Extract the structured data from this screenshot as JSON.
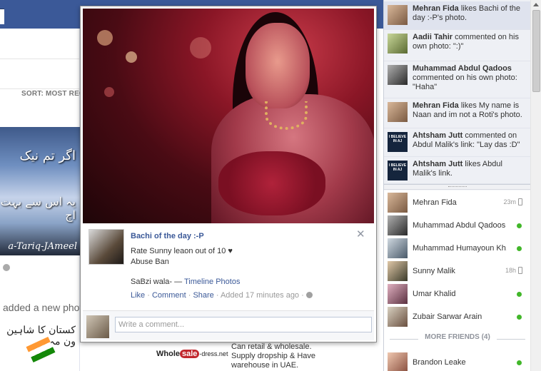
{
  "background": {
    "sort_label": "SORT: MOST REC",
    "added_text": "added a new photo",
    "image_caption_urdu_1": "اگر تم نیک",
    "image_caption_urdu_2": "یہ اس سے بہت اچ",
    "image_signature": "a-Tariq-JAmeel",
    "post_urdu_text": "کستان کا شاہین ون مہ",
    "ad_logo_pre": "Whole",
    "ad_logo_sale": "sale",
    "ad_logo_post": "-dress.net",
    "ad_text": "Can retail & wholesale. Supply dropship & Have warehouse in UAE."
  },
  "photo_viewer": {
    "album_title": "Bachi of the day :-P",
    "caption_line_1": "Rate Sunny leaon out of 10 ♥",
    "caption_line_2": "Abuse Ban",
    "source_prefix": "SaBzi wala- — ",
    "source_link": "Timeline Photos",
    "like": "Like",
    "comment": "Comment",
    "share": "Share",
    "timestamp": "Added 17 minutes ago",
    "close_glyph": "✕",
    "comment_placeholder": "Write a comment..."
  },
  "ticker": [
    {
      "name": "Mehran Fida",
      "text": " likes Bachi of the day :-P's photo.",
      "active": true,
      "avatar": "photo"
    },
    {
      "name": "Aadii Tahir",
      "text": " commented on his own photo: \":)\"",
      "active": false,
      "avatar": "photo"
    },
    {
      "name": "Muhammad Abdul Qadoos",
      "text": " commented on his own photo: \"Haha\"",
      "active": false,
      "avatar": "photo"
    },
    {
      "name": "Mehran Fida",
      "text": " likes My name is Naan and im not a Roti's photo.",
      "active": false,
      "avatar": "photo"
    },
    {
      "name": "Ahtsham Jutt",
      "text": " commented on Abdul Malik's link: \"Lay das :D\"",
      "active": false,
      "avatar": "believe"
    },
    {
      "name": "Ahtsham Jutt",
      "text": " likes Abdul Malik's link.",
      "active": false,
      "avatar": "believe"
    }
  ],
  "believe_badge": "I BELIEVE IN AJ",
  "chat": {
    "friends": [
      {
        "name": "Mehran Fida",
        "status": "mobile",
        "idle": "23m"
      },
      {
        "name": "Muhammad Abdul Qadoos",
        "status": "online",
        "idle": ""
      },
      {
        "name": "Muhammad Humayoun Kh...",
        "status": "online",
        "idle": ""
      },
      {
        "name": "Sunny Malik",
        "status": "mobile",
        "idle": "18h"
      },
      {
        "name": "Umar Khalid",
        "status": "online",
        "idle": ""
      },
      {
        "name": "Zubair Sarwar Arain",
        "status": "online",
        "idle": ""
      }
    ],
    "more_friends_label": "MORE FRIENDS (4)",
    "more_friends": [
      {
        "name": "Brandon Leake",
        "status": "online",
        "idle": ""
      }
    ]
  },
  "colors": {
    "facebook_blue": "#3b5998",
    "link": "#3b5998",
    "online": "#42b72a",
    "ticker_bg": "#eef0f5"
  },
  "icons": [
    "close-icon",
    "globe-icon",
    "online-dot-icon",
    "mobile-phone-icon",
    "scroll-up-arrow-icon"
  ]
}
